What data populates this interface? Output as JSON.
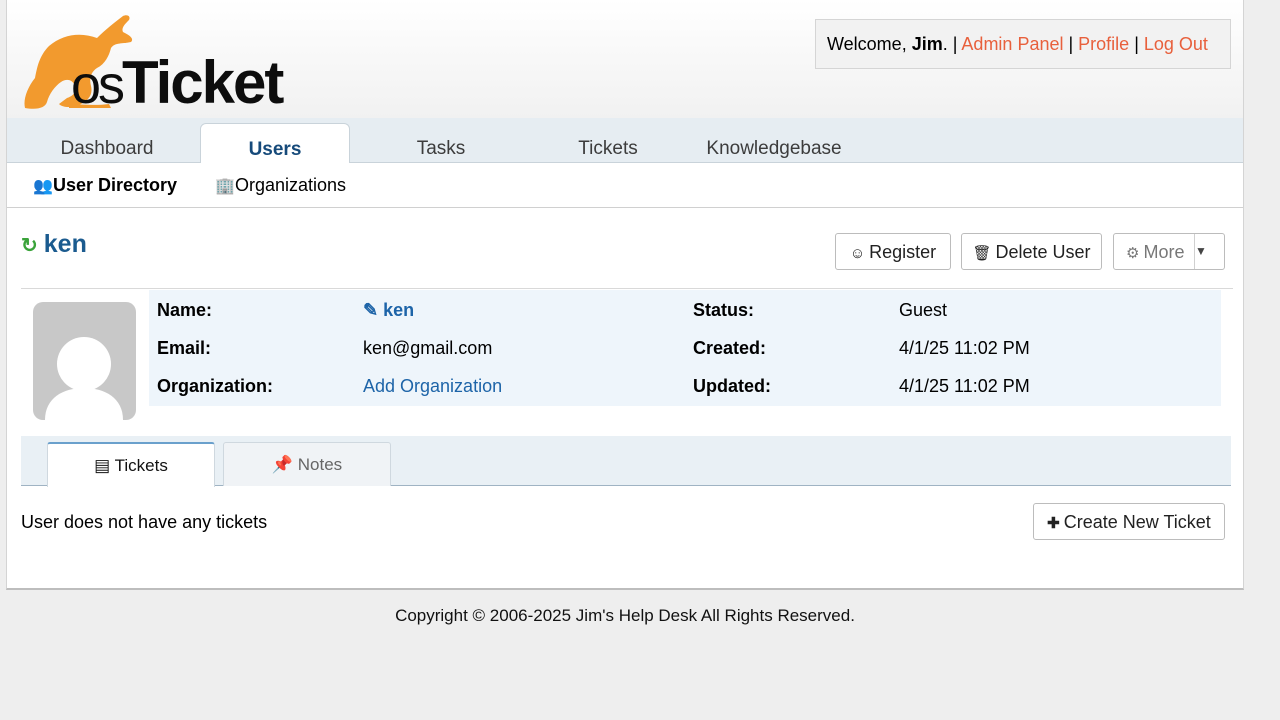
{
  "logo": {
    "os": "os",
    "ticket": "Ticket"
  },
  "welcome": {
    "prefix": "Welcome, ",
    "user": "Jim",
    "sep1": ". | ",
    "admin_panel": "Admin Panel",
    "sep2": " | ",
    "profile": "Profile",
    "sep3": " | ",
    "logout": "Log Out"
  },
  "nav": {
    "tabs": [
      {
        "label": "Dashboard"
      },
      {
        "label": "Users"
      },
      {
        "label": "Tasks"
      },
      {
        "label": "Tickets"
      },
      {
        "label": "Knowledgebase"
      }
    ],
    "active": "Users"
  },
  "subnav": {
    "user_directory": "User Directory",
    "organizations": "Organizations"
  },
  "user": {
    "name": "ken",
    "buttons": {
      "register": "Register",
      "delete": "Delete User",
      "more": "More"
    }
  },
  "info": {
    "name_label": "Name:",
    "name_value": "ken",
    "email_label": "Email:",
    "email_value": "ken@gmail.com",
    "org_label": "Organization:",
    "org_value": "Add Organization",
    "status_label": "Status:",
    "status_value": "Guest",
    "created_label": "Created:",
    "created_value": "4/1/25 11:02 PM",
    "updated_label": "Updated:",
    "updated_value": "4/1/25 11:02 PM"
  },
  "panel_tabs": {
    "tickets": "Tickets",
    "notes": "Notes"
  },
  "tickets": {
    "empty_message": "User does not have any tickets",
    "create_button": "Create New Ticket"
  },
  "footer": "Copyright © 2006-2025 Jim's Help Desk All Rights Reserved.",
  "colors": {
    "accent_link": "#e8603c",
    "title_blue": "#1b5b8f",
    "logo_orange": "#f29a2e"
  }
}
